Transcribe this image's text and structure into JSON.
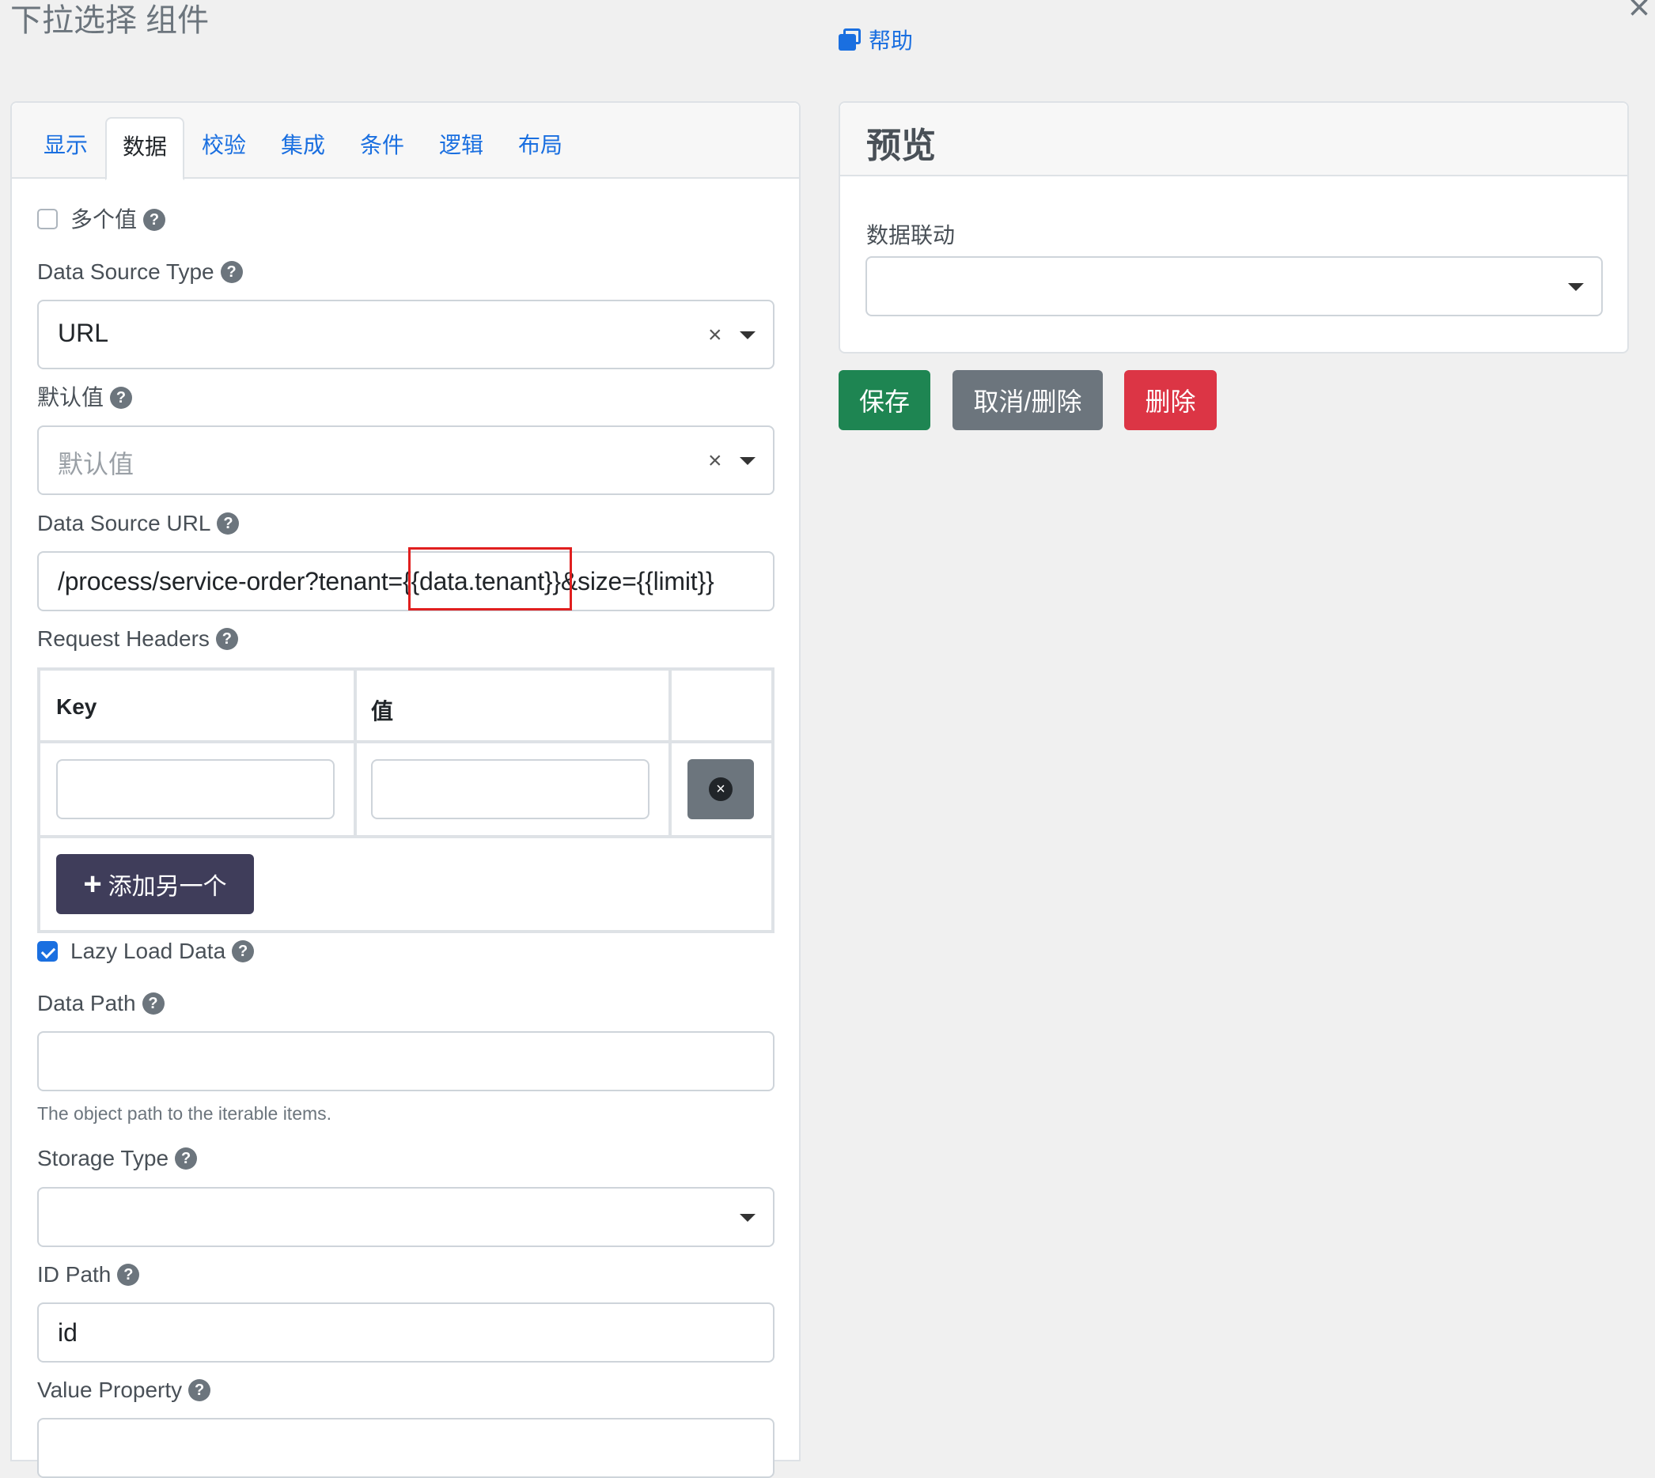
{
  "dialog": {
    "title": "下拉选择 组件",
    "close_glyph": "×",
    "help_label": "帮助"
  },
  "tabs": [
    {
      "label": "显示",
      "active": false
    },
    {
      "label": "数据",
      "active": true
    },
    {
      "label": "校验",
      "active": false
    },
    {
      "label": "集成",
      "active": false
    },
    {
      "label": "条件",
      "active": false
    },
    {
      "label": "逻辑",
      "active": false
    },
    {
      "label": "布局",
      "active": false
    }
  ],
  "form": {
    "multiple_values": {
      "label": "多个值",
      "checked": false
    },
    "data_source_type": {
      "label": "Data Source Type",
      "value": "URL"
    },
    "default_value": {
      "label": "默认值",
      "placeholder": "默认值"
    },
    "data_source_url": {
      "label": "Data Source URL",
      "value": "/process/service-order?tenant={{data.tenant}}&size={{limit}}"
    },
    "request_headers": {
      "label": "Request Headers",
      "columns": [
        "Key",
        "值"
      ],
      "add_button_label": "添加另一个",
      "add_button_glyph": "+",
      "remove_glyph": "×"
    },
    "lazy_load": {
      "label": "Lazy Load Data",
      "checked": true
    },
    "data_path": {
      "label": "Data Path",
      "value": "",
      "help": "The object path to the iterable items."
    },
    "storage_type": {
      "label": "Storage Type",
      "value": ""
    },
    "id_path": {
      "label": "ID Path",
      "value": "id"
    },
    "value_property": {
      "label": "Value Property"
    }
  },
  "preview": {
    "title": "预览",
    "field_label": "数据联动"
  },
  "actions": {
    "save": "保存",
    "cancel": "取消/删除",
    "delete": "删除"
  },
  "colors": {
    "link_blue": "#1a6fe0",
    "save_green": "#1e8552",
    "cancel_gray": "#6c757d",
    "delete_red": "#dc3545",
    "add_button": "#3f3d5a",
    "highlight_red": "#e01f1f"
  }
}
